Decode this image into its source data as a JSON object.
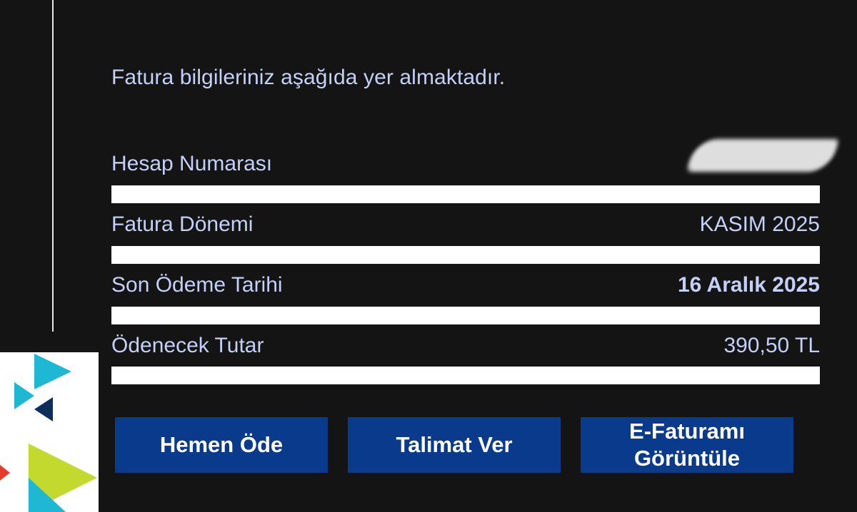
{
  "intro": "Fatura bilgileriniz aşağıda yer almaktadır.",
  "rows": [
    {
      "label": "Hesap Numarası",
      "value": ""
    },
    {
      "label": "Fatura Dönemi",
      "value": "KASIM 2025"
    },
    {
      "label": "Son Ödeme Tarihi",
      "value": "16 Aralık 2025"
    },
    {
      "label": "Ödenecek Tutar",
      "value": "390,50 TL"
    }
  ],
  "buttons": {
    "pay_now": "Hemen Öde",
    "instruction": "Talimat Ver",
    "einvoice_line1": "E-Faturamı",
    "einvoice_line2": "Görüntüle"
  },
  "colors": {
    "background": "#141414",
    "text": "#c4d0f8",
    "button": "#0a3a8c"
  },
  "icons": [
    "brand-logo-triangles"
  ]
}
